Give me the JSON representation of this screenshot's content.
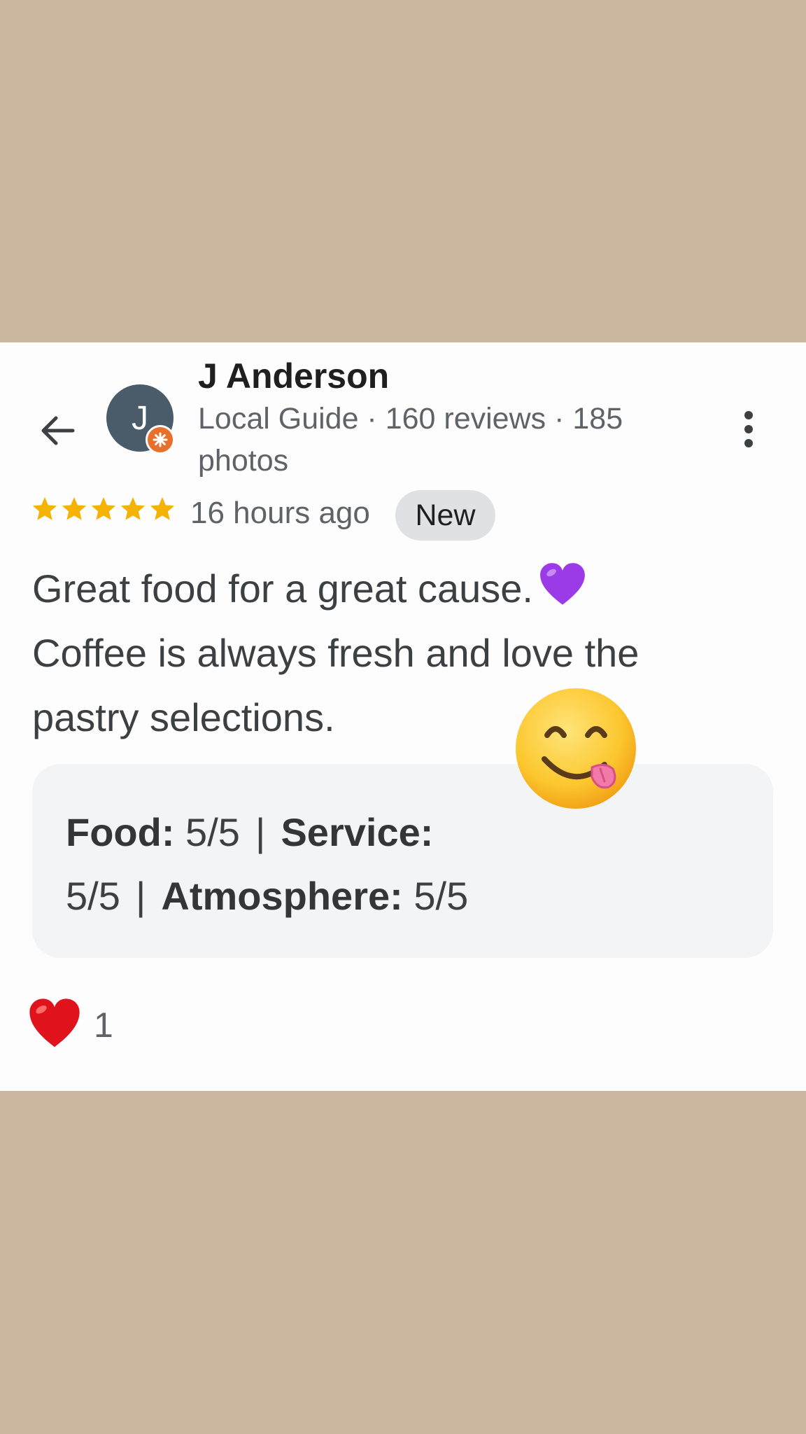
{
  "colors": {
    "background": "#cbb79f",
    "card": "#fdfdfe",
    "avatar": "#4a5b69",
    "guide_badge": "#e8702a",
    "star": "#f5b201",
    "badge_bg": "#dfe1e4",
    "ratings_bg": "#f3f4f6"
  },
  "icons": {
    "back": "arrow-left-icon",
    "more": "more-vert-icon",
    "guide_badge": "local-guide-badge-icon",
    "star": "star-icon",
    "inline_emoji": "purple-heart-icon",
    "sticker": "face-savoring-food-icon",
    "reaction": "red-heart-icon"
  },
  "reviewer": {
    "avatar_initial": "J",
    "name": "J Anderson",
    "meta": "Local Guide · 160 reviews · 185 photos"
  },
  "review": {
    "rating": 5,
    "max_rating": 5,
    "time": "16 hours ago",
    "badge": "New",
    "text_lines": [
      "Great food for a great cause.",
      "Coffee is always fresh and love the",
      "pastry selections."
    ]
  },
  "ratings": {
    "food_label": "Food:",
    "food_value": "5/5",
    "service_label": "Service:",
    "service_value": "5/5",
    "atmosphere_label": "Atmosphere:",
    "atmosphere_value": "5/5",
    "separator": "|"
  },
  "reactions": {
    "count": "1"
  }
}
